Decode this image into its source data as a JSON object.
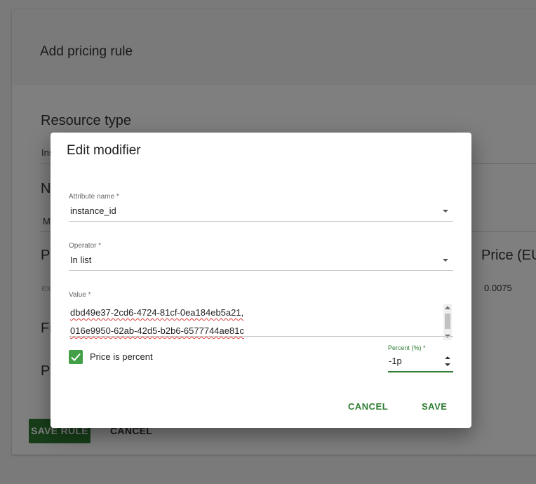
{
  "background_page": {
    "title": "Add pricing rule",
    "resource_type_label": "Resource type",
    "resource_type_value_partial": "Ins",
    "section_letter_n": "N",
    "field_letter_m": "M",
    "section_letter_p": "P",
    "placeholder_partial": "ex",
    "price_label_partial": "Price (EU",
    "price_value": "0.0075",
    "section_letter_fi": "Fi",
    "section_letter_p2": "P",
    "save_rule_button": "SAVE RULE",
    "cancel_button": "CANCEL"
  },
  "dialog": {
    "title": "Edit modifier",
    "attribute": {
      "label": "Attribute name *",
      "value": "instance_id"
    },
    "operator": {
      "label": "Operator *",
      "value": "In list"
    },
    "value_field": {
      "label": "Value *",
      "lines": [
        "dbd49e37-2cd6-4724-81cf-0ea184eb5a21,",
        "016e9950-62ab-42d5-b2b6-6577744ae81c"
      ]
    },
    "price_is_percent": {
      "label": "Price is percent",
      "checked": true
    },
    "percent": {
      "label": "Percent (%) *",
      "value": "-1p"
    },
    "cancel_label": "CANCEL",
    "save_label": "SAVE"
  },
  "colors": {
    "accent": "#2e7d32",
    "checkbox": "#43a047"
  }
}
